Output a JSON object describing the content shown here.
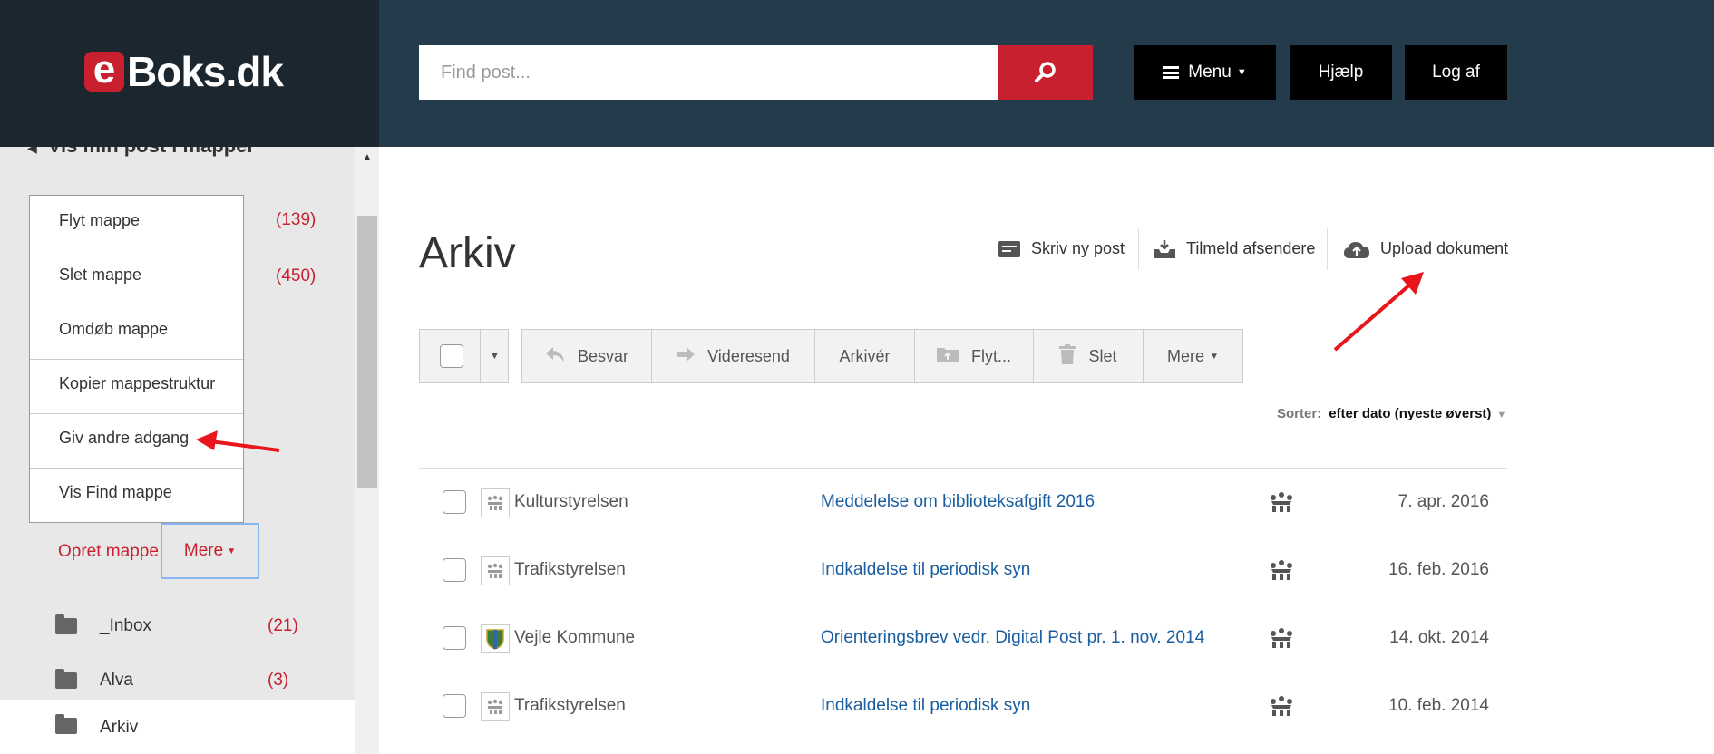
{
  "header": {
    "logo_e": "e",
    "logo_text": "Boks.dk",
    "search_placeholder": "Find post...",
    "menu_label": "Menu",
    "help_label": "Hjælp",
    "logout_label": "Log af"
  },
  "sidebar": {
    "heading": "Vis min post i mapper",
    "counts": [
      "(139)",
      "(450)"
    ],
    "context_menu": [
      "Flyt mappe",
      "Slet mappe",
      "Omdøb mappe",
      "Kopier mappestruktur",
      "Giv andre adgang",
      "Vis Find mappe"
    ],
    "create_folder": "Opret mappe",
    "more_label": "Mere",
    "folders": [
      {
        "name": "_Inbox",
        "count": "(21)"
      },
      {
        "name": "Alva",
        "count": "(3)"
      },
      {
        "name": "Arkiv",
        "count": ""
      }
    ]
  },
  "main": {
    "title": "Arkiv",
    "actions": {
      "write": "Skriv ny post",
      "subscribe": "Tilmeld afsendere",
      "upload": "Upload dokument"
    },
    "toolbar": {
      "reply": "Besvar",
      "forward": "Videresend",
      "archive": "Arkivér",
      "move": "Flyt...",
      "delete": "Slet",
      "more": "Mere"
    },
    "sort": {
      "label": "Sorter:",
      "value": "efter dato (nyeste øverst)"
    },
    "messages": [
      {
        "sender": "Kulturstyrelsen",
        "subject": "Meddelelse om biblioteksafgift 2016",
        "date": "7. apr. 2016",
        "icon": "crown-icon"
      },
      {
        "sender": "Trafikstyrelsen",
        "subject": "Indkaldelse til periodisk syn",
        "date": "16. feb. 2016",
        "icon": "crown-icon"
      },
      {
        "sender": "Vejle Kommune",
        "subject": "Orienteringsbrev vedr. Digital Post pr. 1. nov. 2014",
        "date": "14. okt. 2014",
        "icon": "municipal-shield-icon"
      },
      {
        "sender": "Trafikstyrelsen",
        "subject": "Indkaldelse til periodisk syn",
        "date": "10. feb. 2014",
        "icon": "crown-icon"
      }
    ]
  },
  "colors": {
    "brand_red": "#c8202f",
    "header_dark": "#1b262e",
    "header_blue": "#243b4b",
    "link_blue": "#1a5ea0",
    "annotation_red": "#e8151b"
  }
}
